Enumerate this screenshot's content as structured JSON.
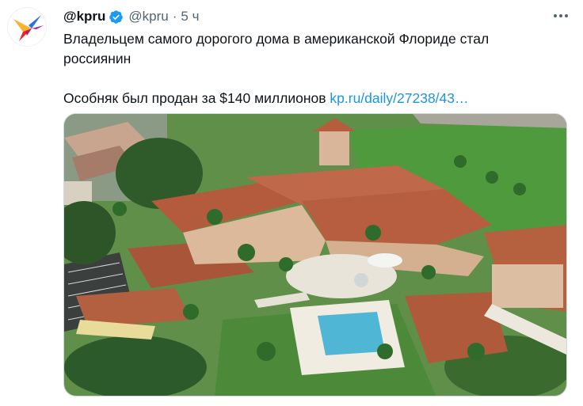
{
  "author": {
    "display_name": "@kpru",
    "handle": "@kpru",
    "separator": "·",
    "time": "5 ч",
    "verified": true,
    "avatar_icon": "kp-bird-logo-icon",
    "brand_colors": [
      "#e8262b",
      "#f7b32b",
      "#9c2aa6",
      "#2f6fe0"
    ]
  },
  "tweet": {
    "line1": "Владельцем самого дорогого дома в американской Флориде стал",
    "line2": "россиянин",
    "line3_prefix": "Особняк был продан за $140 миллионов ",
    "link_text": "kp.ru/daily/27238/43…"
  },
  "media": {
    "subject": "aerial-mansion-photo"
  },
  "colors": {
    "text": "#0f1419",
    "secondary": "#536471",
    "link": "#1b95e0",
    "verified": "#1d9bf0"
  }
}
